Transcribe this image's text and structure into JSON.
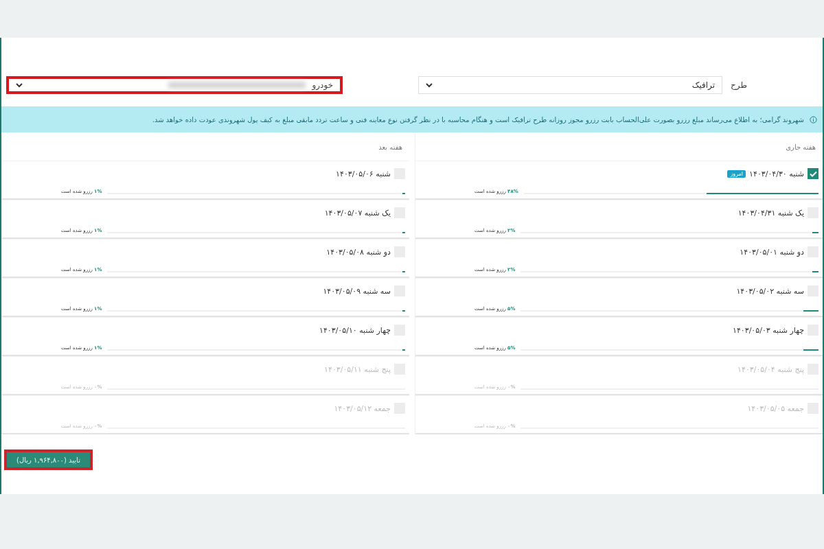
{
  "filters": [
    {
      "label": "طرح",
      "value": "ترافیک"
    },
    {
      "label": "خودرو",
      "blurred": true,
      "highlighted": true
    }
  ],
  "notice": "شهروند گرامی؛ به اطلاع می‌رساند مبلغ رزرو بصورت علی‌الحساب بابت رزرو مجوز روزانه طرح ترافیک است و هنگام محاسبه با در نظر گرفتن نوع معاینه فنی و ساعت تردد مابقی مبلغ به کیف پول شهروندی عودت داده خواهد شد.",
  "weeks": [
    {
      "title": "هفته جاری",
      "days": [
        {
          "label": "شنبه ۱۴۰۳/۰۴/۳۰",
          "badge": "امروز",
          "checked": true,
          "disabled": false,
          "level": 0.38,
          "percent": "۳۸%",
          "reserved_text": "رزرو شده است"
        },
        {
          "label": "یک شنبه ۱۴۰۳/۰۴/۳۱",
          "checked": false,
          "disabled": false,
          "level": 0.02,
          "percent": "۲%",
          "reserved_text": "رزرو شده است"
        },
        {
          "label": "دو شنبه ۱۴۰۳/۰۵/۰۱",
          "checked": false,
          "disabled": false,
          "level": 0.02,
          "percent": "۲%",
          "reserved_text": "رزرو شده است"
        },
        {
          "label": "سه شنبه ۱۴۰۳/۰۵/۰۲",
          "checked": false,
          "disabled": false,
          "level": 0.05,
          "percent": "۵%",
          "reserved_text": "رزرو شده است"
        },
        {
          "label": "چهار شنبه ۱۴۰۳/۰۵/۰۳",
          "checked": false,
          "disabled": false,
          "level": 0.05,
          "percent": "۵%",
          "reserved_text": "رزرو شده است"
        },
        {
          "label": "پنج شنبه ۱۴۰۳/۰۵/۰۴",
          "checked": false,
          "disabled": true,
          "level": 0,
          "percent": "۰%",
          "reserved_text": "رزرو شده است"
        },
        {
          "label": "جمعه ۱۴۰۳/۰۵/۰۵",
          "checked": false,
          "disabled": true,
          "level": 0,
          "percent": "۰%",
          "reserved_text": "رزرو شده است"
        }
      ]
    },
    {
      "title": "هفته بعد",
      "days": [
        {
          "label": "شنبه ۱۴۰۳/۰۵/۰۶",
          "checked": false,
          "disabled": false,
          "level": 0.01,
          "percent": "۱%",
          "reserved_text": "رزرو شده است"
        },
        {
          "label": "یک شنبه ۱۴۰۳/۰۵/۰۷",
          "checked": false,
          "disabled": false,
          "level": 0.01,
          "percent": "۱%",
          "reserved_text": "رزرو شده است"
        },
        {
          "label": "دو شنبه ۱۴۰۳/۰۵/۰۸",
          "checked": false,
          "disabled": false,
          "level": 0.01,
          "percent": "۱%",
          "reserved_text": "رزرو شده است"
        },
        {
          "label": "سه شنبه ۱۴۰۳/۰۵/۰۹",
          "checked": false,
          "disabled": false,
          "level": 0.01,
          "percent": "۱%",
          "reserved_text": "رزرو شده است"
        },
        {
          "label": "چهار شنبه ۱۴۰۳/۰۵/۱۰",
          "checked": false,
          "disabled": false,
          "level": 0.01,
          "percent": "۱%",
          "reserved_text": "رزرو شده است"
        },
        {
          "label": "پنج شنبه ۱۴۰۳/۰۵/۱۱",
          "checked": false,
          "disabled": true,
          "level": 0,
          "percent": "۰%",
          "reserved_text": "رزرو شده است"
        },
        {
          "label": "جمعه ۱۴۰۳/۰۵/۱۲",
          "checked": false,
          "disabled": true,
          "level": 0,
          "percent": "۰%",
          "reserved_text": "رزرو شده است"
        }
      ]
    }
  ],
  "confirm": {
    "label": "تایید (۱,۹۶۴,۸۰۰ ریال)",
    "highlighted": true
  }
}
